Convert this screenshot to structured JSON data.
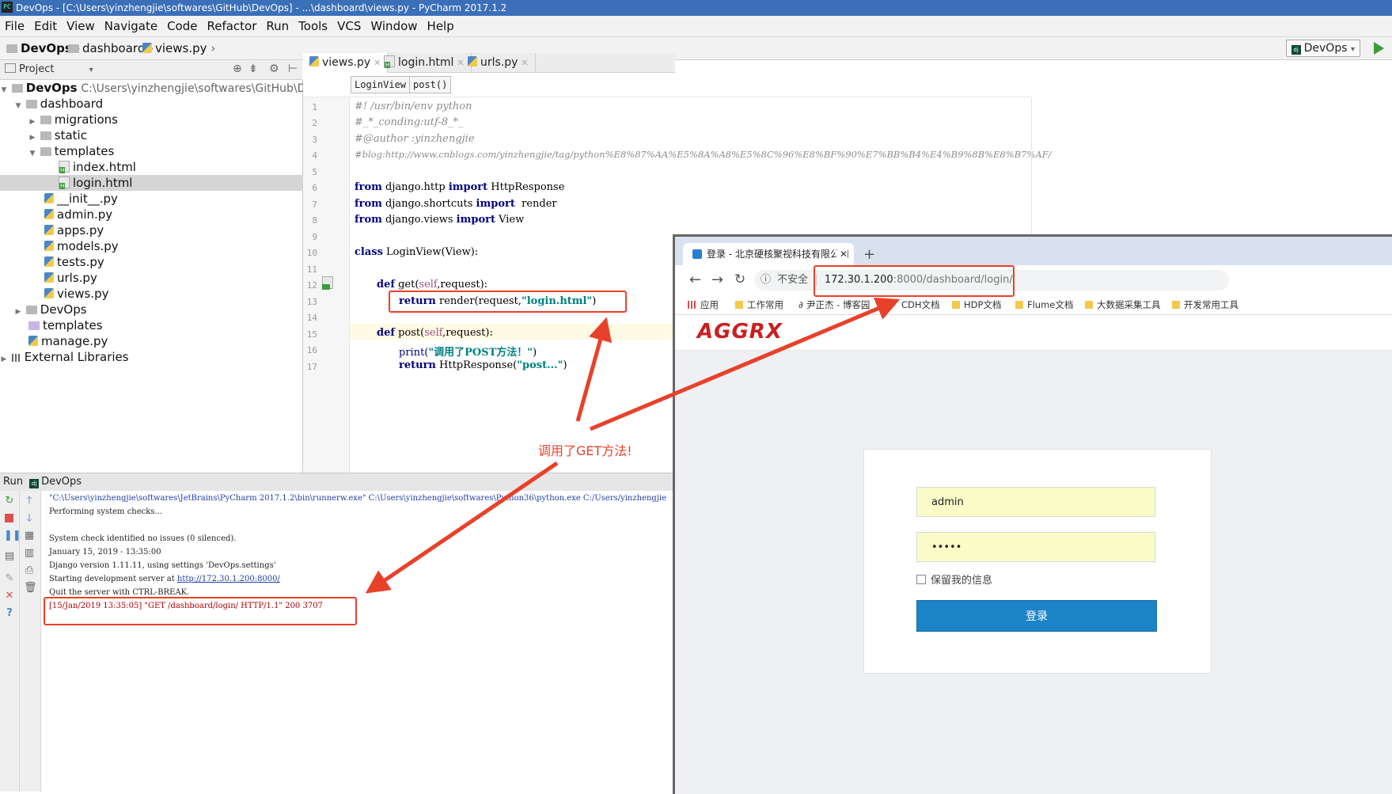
{
  "window": {
    "title": "DevOps - [C:\\Users\\yinzhengjie\\softwares\\GitHub\\DevOps] - ...\\dashboard\\views.py - PyCharm 2017.1.2",
    "app_icon": "PC"
  },
  "menu": [
    "File",
    "Edit",
    "View",
    "Navigate",
    "Code",
    "Refactor",
    "Run",
    "Tools",
    "VCS",
    "Window",
    "Help"
  ],
  "navbar": {
    "crumbs": [
      "DevOps",
      "dashboard",
      "views.py"
    ],
    "run_config": "DevOps"
  },
  "project": {
    "header": "Project",
    "root": "DevOps",
    "root_path": "C:\\Users\\yinzhengjie\\softwares\\GitHub\\DevOps",
    "dashboard": "dashboard",
    "migrations": "migrations",
    "static": "static",
    "templates": "templates",
    "index_html": "index.html",
    "login_html": "login.html",
    "init_py": "__init__.py",
    "admin_py": "admin.py",
    "apps_py": "apps.py",
    "models_py": "models.py",
    "tests_py": "tests.py",
    "urls_py": "urls.py",
    "views_py": "views.py",
    "devops_pkg": "DevOps",
    "templates_root": "templates",
    "manage_py": "manage.py",
    "external_libs": "External Libraries"
  },
  "editor": {
    "tabs": [
      "views.py",
      "login.html",
      "urls.py"
    ],
    "breadcrumbs": [
      "LoginView",
      "post()"
    ],
    "line_numbers": [
      "1",
      "2",
      "3",
      "4",
      "5",
      "6",
      "7",
      "8",
      "9",
      "10",
      "11",
      "12",
      "13",
      "14",
      "15",
      "16",
      "17"
    ],
    "lines": {
      "l1": "#! /usr/bin/env python",
      "l2": "#_*_conding:utf-8_*_",
      "l3": "#@author :yinzhengjie",
      "l4": "#blog:http://www.cnblogs.com/yinzhengjie/tag/python%E8%87%AA%E5%8A%A8%E5%8C%96%E8%BF%90%E7%BB%B4%E4%B9%8B%E8%B7%AF/",
      "kw_from": "from",
      "kw_import": "import",
      "l6_mod": " django.http ",
      "l6_name": " HttpResponse",
      "l7_mod": " django.shortcuts ",
      "l7_name": "  render",
      "l8_mod": " django.views ",
      "l8_name": " View",
      "kw_class": "class",
      "l10_rest": " LoginView(View):",
      "kw_def": "def",
      "l12_a": " get(",
      "self": "self",
      "l12_b": ",request):",
      "kw_return": "return",
      "l13_a": " render(request,",
      "l13_str": "\"login.html\"",
      "l13_b": ")",
      "l15_a": " post(",
      "l15_b": ",request):",
      "l16_a": "print(",
      "l16_str": "\"调用了POST方法！\"",
      "l16_b": ")",
      "l17_a": " HttpResponse(",
      "l17_str": "\"post...\"",
      "l17_b": ")"
    }
  },
  "run": {
    "header_label": "Run",
    "config": "DevOps",
    "console": {
      "cmd": "\"C:\\Users\\yinzhengjie\\softwares\\JetBrains\\PyCharm 2017.1.2\\bin\\runnerw.exe\" C:\\Users\\yinzhengjie\\softwares\\Python36\\python.exe C:/Users/yinzhengjie",
      "l2": "Performing system checks...",
      "l3": "System check identified no issues (0 silenced).",
      "l4": "January 15, 2019 - 13:35:00",
      "l5": "Django version 1.11.11, using settings 'DevOps.settings'",
      "l6_prefix": "Starting development server at ",
      "l6_link": "http://172.30.1.200:8000/",
      "l7": "Quit the server with CTRL-BREAK.",
      "l8": "[15/Jan/2019 13:35:05] \"GET /dashboard/login/ HTTP/1.1\" 200 3707"
    }
  },
  "browser": {
    "tab_title": "登录 - 北京硬核聚视科技有限公司",
    "insecure_label": "不安全",
    "url_host": "172.30.1.200",
    "url_rest": ":8000/dashboard/login/",
    "bookmarks": [
      "应用",
      "工作常用",
      "尹正杰 - 博客园",
      "CDH文档",
      "HDP文档",
      "Flume文档",
      "大数据采集工具",
      "开发常用工具"
    ],
    "logo": "AGGRX",
    "username": "admin",
    "password_mask": "•••••",
    "remember_label": "保留我的信息",
    "login_button": "登录"
  },
  "annotation": {
    "text": "调用了GET方法!",
    "color": "#e8412a"
  }
}
